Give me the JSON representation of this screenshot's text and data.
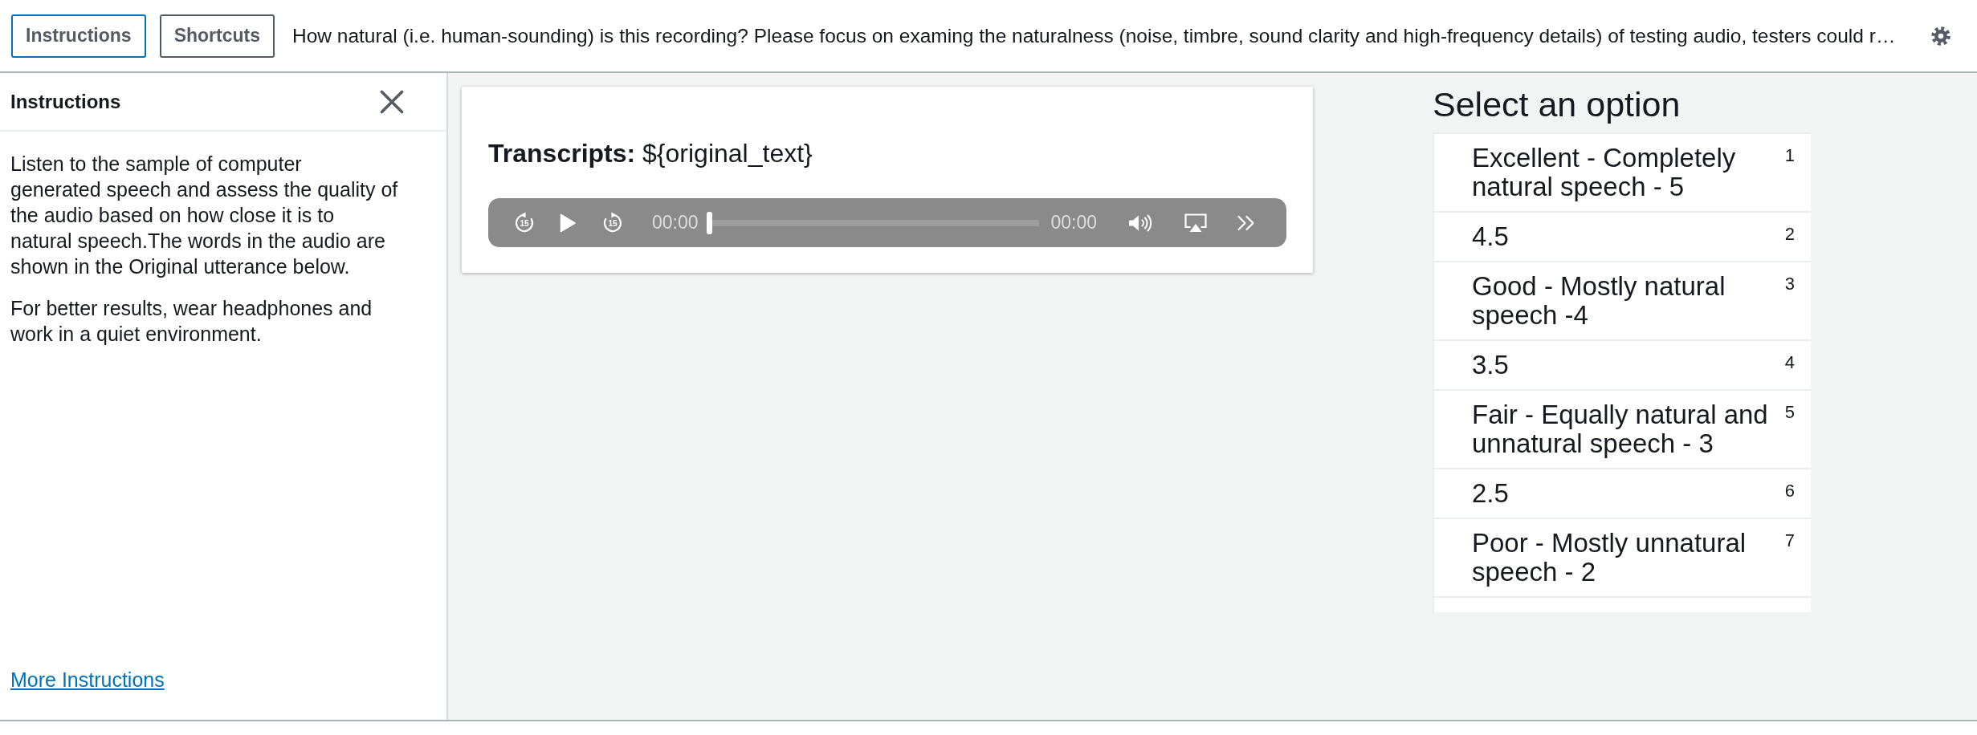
{
  "toolbar": {
    "buttons": [
      {
        "label": "Instructions",
        "selected": true
      },
      {
        "label": "Shortcuts",
        "selected": false
      }
    ],
    "question": "How natural (i.e. human-sounding) is this recording? Please focus on examing the naturalness (noise, timbre, sound clarity and high-frequency details) of testing audio, testers could r…"
  },
  "instructions_panel": {
    "title": "Instructions",
    "paragraphs": [
      "Listen to the sample of computer\ngenerated speech and assess the quality of\nthe audio based on how close it is to\nnatural speech.The words in the audio are\nshown in the Original utterance below.",
      "For better results, wear headphones and work in a quiet environment."
    ],
    "link": "More Instructions"
  },
  "transcript": {
    "text": "**Transcripts:** ${original_text}"
  },
  "player": {
    "skip_back": "15",
    "skip_forward": "15",
    "current_time": "00:00",
    "duration": "00:00",
    "progress": {
      "level": 0
    }
  },
  "options": {
    "title": "Select an option",
    "items": [
      {
        "label": "Excellent - Completely natural speech - 5",
        "shortcut": "1",
        "selected": false
      },
      {
        "label": "4.5",
        "shortcut": "2",
        "selected": false
      },
      {
        "label": "Good - Mostly natural speech -4",
        "shortcut": "3",
        "selected": false
      },
      {
        "label": "3.5",
        "shortcut": "4",
        "selected": false
      },
      {
        "label": "Fair - Equally natural and unnatural speech - 3",
        "shortcut": "5",
        "selected": false
      },
      {
        "label": "2.5",
        "shortcut": "6",
        "selected": false
      },
      {
        "label": "Poor - Mostly unnatural speech - 2",
        "shortcut": "7",
        "selected": false
      }
    ]
  }
}
